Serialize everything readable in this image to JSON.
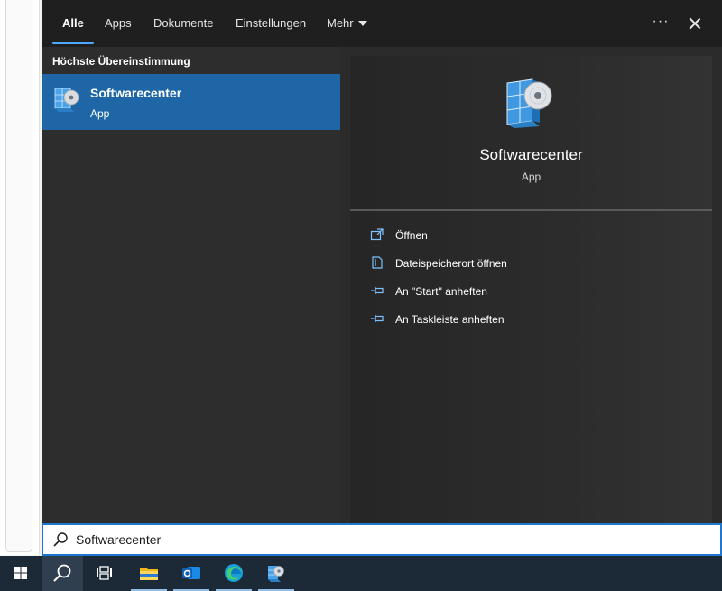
{
  "tabs": [
    {
      "label": "Alle",
      "active": true
    },
    {
      "label": "Apps",
      "active": false
    },
    {
      "label": "Dokumente",
      "active": false
    },
    {
      "label": "Einstellungen",
      "active": false
    },
    {
      "label": "Mehr",
      "active": false
    }
  ],
  "header_icons": {
    "more": "more-options-icon",
    "close": "close-icon"
  },
  "results": {
    "section_title": "Höchste Übereinstimmung",
    "best_match": {
      "name": "Softwarecenter",
      "type": "App",
      "icon": "software-center-icon"
    }
  },
  "detail": {
    "name": "Softwarecenter",
    "type": "App",
    "actions": [
      {
        "label": "Öffnen",
        "icon": "open-icon"
      },
      {
        "label": "Dateispeicherort öffnen",
        "icon": "file-location-icon"
      },
      {
        "label": "An \"Start\" anheften",
        "icon": "pin-icon"
      },
      {
        "label": "An Taskleiste anheften",
        "icon": "pin-icon"
      }
    ]
  },
  "search": {
    "value": "Softwarecenter",
    "icon": "search-icon"
  },
  "taskbar": {
    "items": [
      {
        "icon": "windows-start-icon"
      },
      {
        "icon": "search-icon",
        "active": true
      },
      {
        "icon": "task-view-icon"
      },
      {
        "icon": "file-explorer-icon",
        "running": true
      },
      {
        "icon": "outlook-icon",
        "running": true
      },
      {
        "icon": "edge-icon",
        "running": true
      },
      {
        "icon": "software-center-icon",
        "running": true
      }
    ]
  },
  "colors": {
    "accent": "#1e66a6",
    "tab_underline": "#4ea8ff",
    "search_border": "#1e78d2",
    "taskbar": "#1c2a37"
  }
}
